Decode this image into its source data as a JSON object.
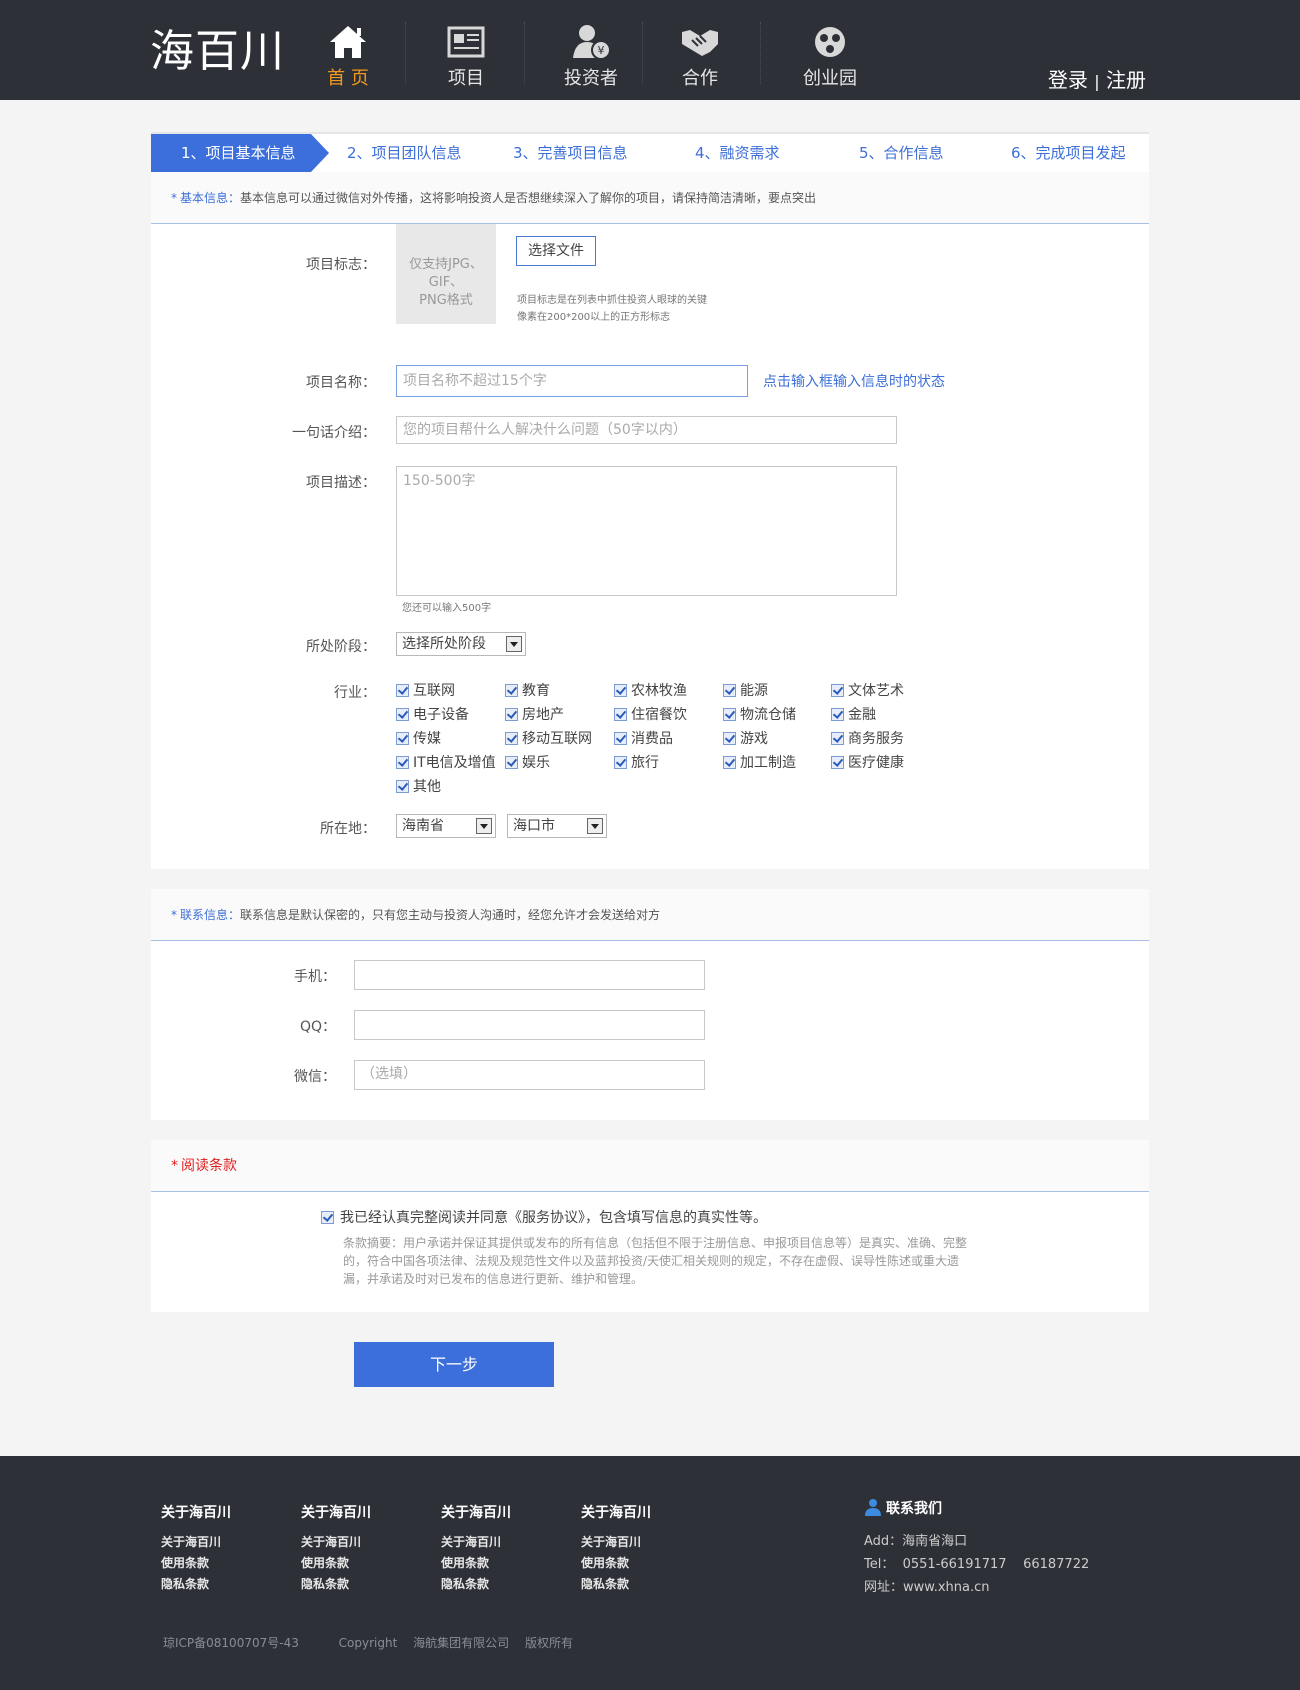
{
  "header": {
    "logo": "海百川",
    "nav": [
      {
        "label": "首 页",
        "icon": "home-icon",
        "active": true
      },
      {
        "label": "项目",
        "icon": "news-icon"
      },
      {
        "label": "投资者",
        "icon": "investor-icon"
      },
      {
        "label": "合作",
        "icon": "handshake-icon"
      },
      {
        "label": "创业园",
        "icon": "park-icon"
      }
    ],
    "login": "登录",
    "sep": "|",
    "register": "注册"
  },
  "steps": [
    "1、项目基本信息",
    "2、项目团队信息",
    "3、完善项目信息",
    "4、融资需求",
    "5、合作信息",
    "6、完成项目发起"
  ],
  "basic": {
    "head_star": "*",
    "head_key": "基本信息：",
    "head_text": "基本信息可以通过微信对外传播，这将影响投资人是否想继续深入了解你的项目，请保持简洁清晰，要点突出",
    "logo_label": "项目标志：",
    "logo_placeholder_1": "仅支持JPG、GIF、",
    "logo_placeholder_2": "PNG格式",
    "file_button": "选择文件",
    "logo_tip_1": "项目标志是在列表中抓住投资人眼球的关键",
    "logo_tip_2": "像素在200*200以上的正方形标志",
    "name_label": "项目名称：",
    "name_placeholder": "项目名称不超过15个字",
    "name_hint": "点击输入框输入信息时的状态",
    "intro_label": "一句话介绍：",
    "intro_placeholder": "您的项目帮什么人解决什么问题（50字以内）",
    "desc_label": "项目描述：",
    "desc_placeholder": "150-500字",
    "desc_counter": "您还可以输入500字",
    "stage_label": "所处阶段：",
    "stage_value": "选择所处阶段",
    "industry_label": "行业：",
    "industries": [
      [
        "互联网",
        "教育",
        "农林牧渔",
        "能源",
        "文体艺术"
      ],
      [
        "电子设备",
        "房地产",
        "住宿餐饮",
        "物流仓储",
        "金融"
      ],
      [
        "传媒",
        "移动互联网",
        "消费品",
        "游戏",
        "商务服务"
      ],
      [
        "IT电信及增值",
        "娱乐",
        "旅行",
        "加工制造",
        "医疗健康"
      ],
      [
        "其他"
      ]
    ],
    "location_label": "所在地：",
    "province": "海南省",
    "city": "海口市"
  },
  "contact": {
    "head_star": "*",
    "head_key": "联系信息：",
    "head_text": "联系信息是默认保密的，只有您主动与投资人沟通时，经您允许才会发送给对方",
    "phone_label": "手机：",
    "qq_label": "QQ：",
    "wechat_label": "微信：",
    "wechat_placeholder": "（选填）"
  },
  "terms": {
    "head_star": "*",
    "head_key": "阅读条款",
    "agree_text": "我已经认真完整阅读并同意《服务协议》，包含填写信息的真实性等。",
    "summary_1": "条款摘要：用户承诺并保证其提供或发布的所有信息（包括但不限于注册信息、申报项目信息等）是真实、准确、完整",
    "summary_2": "的，符合中国各项法律、法规及规范性文件以及蓝邦投资/天使汇相关规则的规定，不存在虚假、误导性陈述或重大遗",
    "summary_3": "漏，并承诺及时对已发布的信息进行更新、维护和管理。"
  },
  "next_button": "下一步",
  "footer": {
    "columns": [
      {
        "title": "关于海百川",
        "links": [
          "关于海百川",
          "使用条款",
          "隐私条款"
        ]
      },
      {
        "title": "关于海百川",
        "links": [
          "关于海百川",
          "使用条款",
          "隐私条款"
        ]
      },
      {
        "title": "关于海百川",
        "links": [
          "关于海百川",
          "使用条款",
          "隐私条款"
        ]
      },
      {
        "title": "关于海百川",
        "links": [
          "关于海百川",
          "使用条款",
          "隐私条款"
        ]
      }
    ],
    "contact_title": "联系我们",
    "address": "Add：海南省海口",
    "tel": "Tel：  0551-66191717    66187722",
    "website": "网址：www.xhna.cn",
    "icp": "琼ICP备08100707号-43",
    "copyright": "Copyright",
    "company": "海航集团有限公司",
    "rights": "版权所有"
  },
  "colors": {
    "header_bg": "#2e3038",
    "accent_blue": "#3c6fdb",
    "active_nav": "#f39a1c",
    "required_red": "#e02020"
  }
}
